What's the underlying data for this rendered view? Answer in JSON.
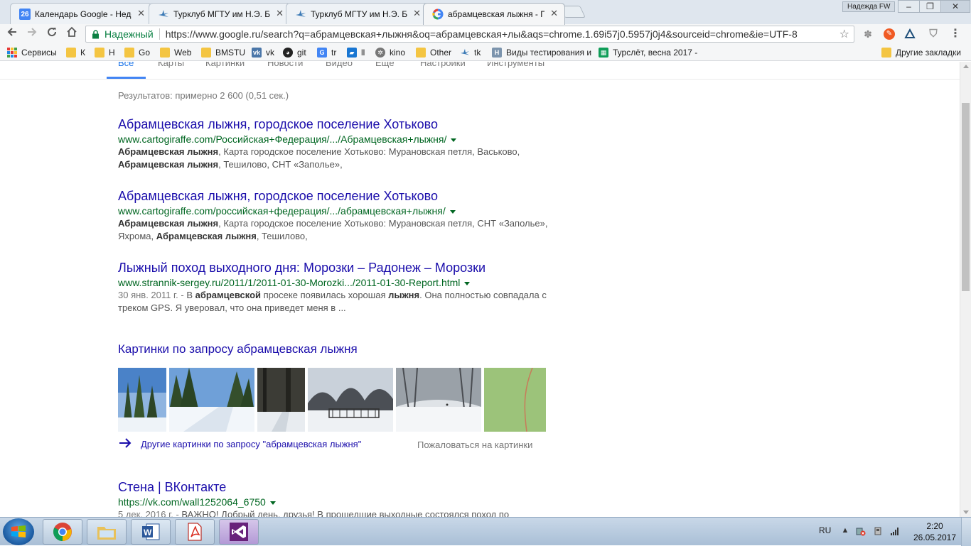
{
  "tabs": [
    {
      "title": "Календарь Google - Недел",
      "icon": "calendar-icon",
      "icon_text": "26",
      "color": "#4285f4"
    },
    {
      "title": "Турклуб МГТУ им Н.Э. Ба",
      "icon": "plane-icon",
      "color": "#3a79b5"
    },
    {
      "title": "Турклуб МГТУ им Н.Э. Ба",
      "icon": "plane-icon",
      "color": "#3a79b5"
    },
    {
      "title": "абрамцевская лыжня - Пои",
      "icon": "google-icon",
      "color": "#4285f4"
    }
  ],
  "profile_name": "Надежда FW",
  "omnibox": {
    "secure_label": "Надежный",
    "url": "https://www.google.ru/search?q=абрамцевская+лыжня&oq=абрамцевская+лы&aqs=chrome.1.69i57j0.5957j0j4&sourceid=chrome&ie=UTF-8"
  },
  "bookmarks": {
    "items": [
      {
        "label": "Сервисы",
        "icon": "apps-icon"
      },
      {
        "label": "К",
        "icon": "folder-icon"
      },
      {
        "label": "Н",
        "icon": "folder-icon"
      },
      {
        "label": "Go",
        "icon": "folder-icon"
      },
      {
        "label": "Web",
        "icon": "folder-icon"
      },
      {
        "label": "BMSTU",
        "icon": "folder-icon"
      },
      {
        "label": "vk",
        "icon": "vk-icon"
      },
      {
        "label": "git",
        "icon": "github-icon"
      },
      {
        "label": "tr",
        "icon": "translate-icon"
      },
      {
        "label": "ll",
        "icon": "book-icon"
      },
      {
        "label": "kino",
        "icon": "film-icon"
      },
      {
        "label": "Other",
        "icon": "folder-icon"
      },
      {
        "label": "tk",
        "icon": "plane-icon"
      },
      {
        "label": "Виды тестирования и",
        "icon": "habr-icon"
      },
      {
        "label": "Турслёт, весна 2017 -",
        "icon": "sheets-icon"
      }
    ],
    "other_label": "Другие закладки"
  },
  "google_nav": [
    "Все",
    "Карты",
    "Картинки",
    "Новости",
    "Видео",
    "Ещё",
    "Настройки",
    "Инструменты"
  ],
  "result_stats": "Результатов: примерно 2 600 (0,51 сек.)",
  "results": [
    {
      "title": "Абрамцевская лыжня, городское поселение Хотьково",
      "url": "www.cartogiraffe.com/Российская+Федерация/.../Абрамцевская+лыжня/",
      "snippet_html": "<b>Абрамцевская лыжня</b>, Карта городское поселение Хотьково: Мурановская петля, Васьково, <b>Абрамцевская лыжня</b>, Тешилово, СНТ «Заполье»,"
    },
    {
      "title": "Абрамцевская лыжня, городское поселение Хотьково",
      "url": "www.cartogiraffe.com/российская+федерация/.../абрамцевская+лыжня/",
      "snippet_html": "<b>Абрамцевская лыжня</b>, Карта городское поселение Хотьково: Мурановская петля, СНТ «Заполье», Яхрома, <b>Абрамцевская лыжня</b>, Тешилово,"
    },
    {
      "title": "Лыжный поход выходного дня: Морозки – Радонеж – Морозки",
      "url": "www.strannik-sergey.ru/2011/1/2011-01-30-Morozki.../2011-01-30-Report.html",
      "date": "30 янв. 2011 г. - ",
      "snippet_html": "В <b>абрамцевской</b> просеке появилась хорошая <b>лыжня</b>. Она полностью совпадала с треком GPS. Я уверовал, что она приведет меня в ..."
    }
  ],
  "images_block": {
    "title": "Картинки по запросу абрамцевская лыжня",
    "more_label": "Другие картинки по запросу \"абрамцевская лыжня\"",
    "report_label": "Пожаловаться на картинки"
  },
  "vk_result": {
    "title": "Стена | ВКонтакте",
    "url": "https://vk.com/wall1252064_6750",
    "date": "5 дек. 2016 г. - ",
    "snippet": "ВАЖНО! Добрый день, друзья! В прошедшие выходные состоялся поход по"
  },
  "taskbar": {
    "apps": [
      "chrome-icon",
      "explorer-icon",
      "word-icon",
      "acrobat-icon",
      "visual-studio-icon"
    ],
    "language": "RU",
    "time": "2:20",
    "date": "26.05.2017"
  }
}
